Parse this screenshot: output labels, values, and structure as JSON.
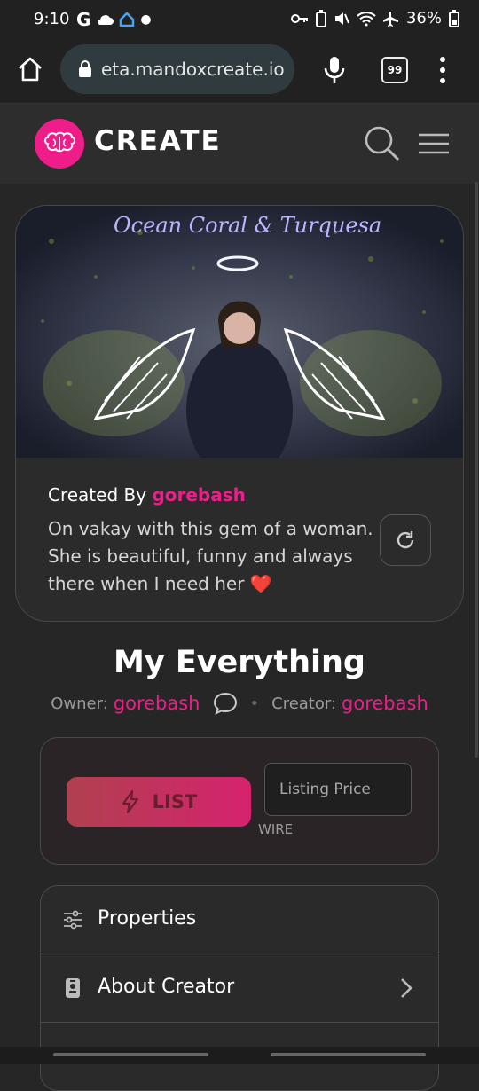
{
  "status": {
    "time": "9:10",
    "battery": "36%",
    "icons": [
      "google-icon",
      "cloud-icon",
      "home-icon",
      "dot-icon",
      "key-icon",
      "battery-saver-icon",
      "mute-icon",
      "wifi-icon",
      "airplane-icon",
      "battery-icon"
    ]
  },
  "browser": {
    "url": "eta.mandoxcreate.io",
    "tab_count": "99"
  },
  "header": {
    "brand": "CREATE",
    "brand_color": "#ee1d89"
  },
  "card": {
    "created_by_label": "Created By",
    "creator": "gorebash",
    "description": "On vakay with this gem of a woman. She is beautiful, funny and always there when I need her ❤️",
    "image_sign": "Ocean Coral & Turquesa"
  },
  "item": {
    "title": "My Everything",
    "owner_label": "Owner:",
    "owner": "gorebash",
    "creator_label": "Creator:",
    "creator": "gorebash"
  },
  "listing": {
    "list_label": "LIST",
    "price_placeholder": "Listing Price",
    "currency": "WIRE"
  },
  "accordion": {
    "items": [
      {
        "label": "Properties",
        "icon": "sliders-icon"
      },
      {
        "label": "About Creator",
        "icon": "id-badge-icon"
      }
    ]
  }
}
